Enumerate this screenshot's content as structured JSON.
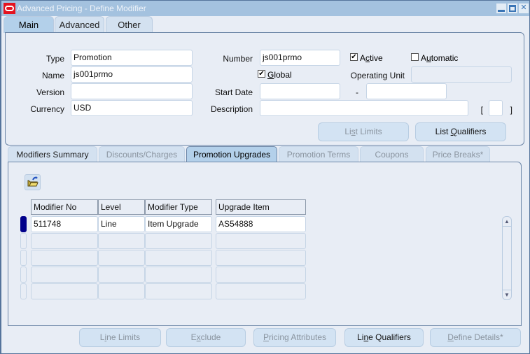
{
  "window": {
    "title": "Advanced Pricing - Define Modifier",
    "controls": [
      "minimize",
      "maximize",
      "close"
    ]
  },
  "main_tabs": [
    {
      "label": "Main",
      "active": true
    },
    {
      "label": "Advanced",
      "active": false
    },
    {
      "label": "Other",
      "active": false
    }
  ],
  "header": {
    "type_label": "Type",
    "type_value": "Promotion",
    "name_label": "Name",
    "name_value": "js001prmo",
    "version_label": "Version",
    "version_value": "",
    "currency_label": "Currency",
    "currency_value": "USD",
    "number_label": "Number",
    "number_value": "js001prmo",
    "active_label": "Active",
    "active_checked": true,
    "automatic_label": "Automatic",
    "automatic_checked": false,
    "global_label": "Global",
    "global_checked": true,
    "operating_unit_label": "Operating Unit",
    "operating_unit_value": "",
    "start_date_label": "Start Date",
    "start_date_value": "",
    "date_separator": "-",
    "end_date_value": "",
    "description_label": "Description",
    "description_value": "",
    "dff_open": "[",
    "dff_close": "]",
    "dff_value": ""
  },
  "header_buttons": {
    "list_limits": "List Limits",
    "list_qualifiers": "List Qualifiers"
  },
  "sub_tabs": [
    {
      "label": "Modifiers Summary",
      "state": "enabled"
    },
    {
      "label": "Discounts/Charges",
      "state": "disabled"
    },
    {
      "label": "Promotion Upgrades",
      "state": "active"
    },
    {
      "label": "Promotion Terms",
      "state": "disabled"
    },
    {
      "label": "Coupons",
      "state": "disabled"
    },
    {
      "label": "Price Breaks*",
      "state": "disabled"
    }
  ],
  "table": {
    "columns": [
      "Modifier No",
      "Level",
      "Modifier Type",
      "Upgrade Item"
    ],
    "rows": [
      [
        "511748",
        "Line",
        "Item Upgrade",
        "AS54888"
      ],
      [
        "",
        "",
        "",
        ""
      ],
      [
        "",
        "",
        "",
        ""
      ],
      [
        "",
        "",
        "",
        ""
      ],
      [
        "",
        "",
        "",
        ""
      ]
    ],
    "current_row": 0
  },
  "icons": {
    "folder": "open-folder-icon",
    "scroll_up": "▲",
    "scroll_down": "▼"
  },
  "footer_buttons": {
    "line_limits": "Line Limits",
    "exclude": "Exclude",
    "pricing_attributes": "Pricing Attributes",
    "line_qualifiers": "Line Qualifiers",
    "define_details": "Define Details*"
  }
}
